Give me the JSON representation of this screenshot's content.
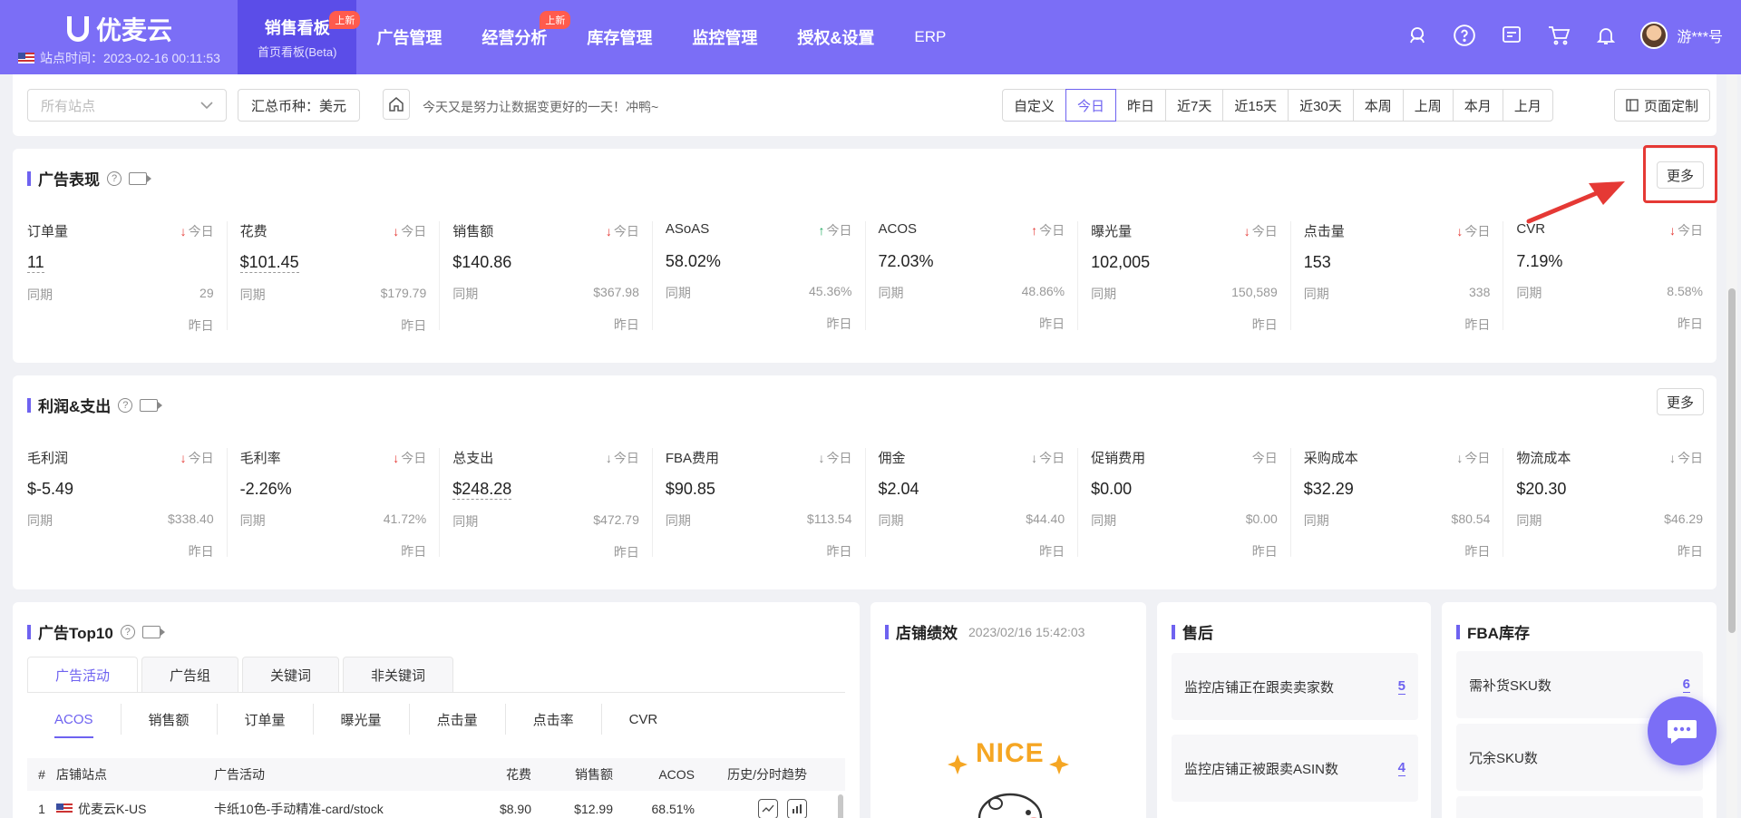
{
  "header": {
    "logo_text": "优麦云",
    "site_time_label": "站点时间：2023-02-16 00:11:53",
    "nav": [
      {
        "label": "销售看板",
        "sub": "首页看板(Beta)",
        "badge": "上新",
        "active": true
      },
      {
        "label": "广告管理",
        "sub": "",
        "badge": "",
        "active": false
      },
      {
        "label": "经营分析",
        "sub": "",
        "badge": "上新",
        "active": false
      },
      {
        "label": "库存管理",
        "sub": "",
        "badge": "",
        "active": false
      },
      {
        "label": "监控管理",
        "sub": "",
        "badge": "",
        "active": false
      },
      {
        "label": "授权&设置",
        "sub": "",
        "badge": "",
        "active": false
      },
      {
        "label": "ERP",
        "sub": "",
        "badge": "",
        "active": false
      }
    ],
    "icons": [
      "headset-icon",
      "help-icon",
      "message-icon",
      "cart-icon",
      "bell-icon"
    ],
    "user_name": "游***号"
  },
  "filters": {
    "site_placeholder": "所有站点",
    "currency_label": "汇总币种：美元",
    "motto": "今天又是努力让数据变更好的一天！冲鸭~",
    "date_ranges": [
      "自定义",
      "今日",
      "昨日",
      "近7天",
      "近15天",
      "近30天",
      "本周",
      "上周",
      "本月",
      "上月"
    ],
    "active_range": "今日",
    "customize_label": "页面定制"
  },
  "ad_performance": {
    "title": "广告表现",
    "more_label": "更多",
    "metrics": [
      {
        "label": "订单量",
        "trend": "down",
        "period": "今日",
        "value": "11",
        "compare_label": "同期",
        "compare_value": "29",
        "sub_label": "昨日",
        "dashed": true
      },
      {
        "label": "花费",
        "trend": "down",
        "period": "今日",
        "value": "$101.45",
        "compare_label": "同期",
        "compare_value": "$179.79",
        "sub_label": "昨日",
        "dashed": true
      },
      {
        "label": "销售额",
        "trend": "down",
        "period": "今日",
        "value": "$140.86",
        "compare_label": "同期",
        "compare_value": "$367.98",
        "sub_label": "昨日",
        "dashed": false
      },
      {
        "label": "ASoAS",
        "trend": "up-green",
        "period": "今日",
        "value": "58.02%",
        "compare_label": "同期",
        "compare_value": "45.36%",
        "sub_label": "昨日",
        "dashed": false
      },
      {
        "label": "ACOS",
        "trend": "up-red",
        "period": "今日",
        "value": "72.03%",
        "compare_label": "同期",
        "compare_value": "48.86%",
        "sub_label": "昨日",
        "dashed": false
      },
      {
        "label": "曝光量",
        "trend": "down",
        "period": "今日",
        "value": "102,005",
        "compare_label": "同期",
        "compare_value": "150,589",
        "sub_label": "昨日",
        "dashed": false
      },
      {
        "label": "点击量",
        "trend": "down",
        "period": "今日",
        "value": "153",
        "compare_label": "同期",
        "compare_value": "338",
        "sub_label": "昨日",
        "dashed": false
      },
      {
        "label": "CVR",
        "trend": "down",
        "period": "今日",
        "value": "7.19%",
        "compare_label": "同期",
        "compare_value": "8.58%",
        "sub_label": "昨日",
        "dashed": false
      }
    ]
  },
  "profit": {
    "title": "利润&支出",
    "more_label": "更多",
    "metrics": [
      {
        "label": "毛利润",
        "trend": "down",
        "period": "今日",
        "value": "$-5.49",
        "compare_label": "同期",
        "compare_value": "$338.40",
        "sub_label": "昨日",
        "dashed": false
      },
      {
        "label": "毛利率",
        "trend": "down",
        "period": "今日",
        "value": "-2.26%",
        "compare_label": "同期",
        "compare_value": "41.72%",
        "sub_label": "昨日",
        "dashed": false
      },
      {
        "label": "总支出",
        "trend": "grey",
        "period": "今日",
        "value": "$248.28",
        "compare_label": "同期",
        "compare_value": "$472.79",
        "sub_label": "昨日",
        "dashed": true
      },
      {
        "label": "FBA费用",
        "trend": "grey",
        "period": "今日",
        "value": "$90.85",
        "compare_label": "同期",
        "compare_value": "$113.54",
        "sub_label": "昨日",
        "dashed": false
      },
      {
        "label": "佣金",
        "trend": "grey",
        "period": "今日",
        "value": "$2.04",
        "compare_label": "同期",
        "compare_value": "$44.40",
        "sub_label": "昨日",
        "dashed": false
      },
      {
        "label": "促销费用",
        "trend": "none",
        "period": "今日",
        "value": "$0.00",
        "compare_label": "同期",
        "compare_value": "$0.00",
        "sub_label": "昨日",
        "dashed": false
      },
      {
        "label": "采购成本",
        "trend": "grey",
        "period": "今日",
        "value": "$32.29",
        "compare_label": "同期",
        "compare_value": "$80.54",
        "sub_label": "昨日",
        "dashed": false
      },
      {
        "label": "物流成本",
        "trend": "grey",
        "period": "今日",
        "value": "$20.30",
        "compare_label": "同期",
        "compare_value": "$46.29",
        "sub_label": "昨日",
        "dashed": false
      }
    ]
  },
  "ad_top10": {
    "title": "广告Top10",
    "tabs": [
      "广告活动",
      "广告组",
      "关键词",
      "非关键词"
    ],
    "active_tab": "广告活动",
    "subtabs": [
      "ACOS",
      "销售额",
      "订单量",
      "曝光量",
      "点击量",
      "点击率",
      "CVR"
    ],
    "active_subtab": "ACOS",
    "columns": {
      "num": "#",
      "store": "店铺站点",
      "campaign": "广告活动",
      "spend": "花费",
      "sales": "销售额",
      "acos": "ACOS",
      "trend": "历史/分时趋势"
    },
    "rows": [
      {
        "num": "1",
        "store": "优麦云K-US",
        "campaign": "卡纸10色-手动精准-card/stock",
        "spend": "$8.90",
        "sales": "$12.99",
        "acos": "68.51%"
      }
    ]
  },
  "store_perf": {
    "title": "店铺绩效",
    "time": "2023/02/16 15:42:03",
    "sticker_text": "NICE"
  },
  "after_sales": {
    "title": "售后",
    "items": [
      {
        "label": "监控店铺正在跟卖卖家数",
        "value": "5"
      },
      {
        "label": "监控店铺正被跟卖ASIN数",
        "value": "4"
      }
    ]
  },
  "fba_inventory": {
    "title": "FBA库存",
    "items": [
      {
        "label": "需补货SKU数",
        "value": "6"
      },
      {
        "label": "冗余SKU数",
        "value": ""
      }
    ]
  },
  "colors": {
    "brand": "#7b6ef6",
    "accent": "#6e62f0",
    "down": "#e53935",
    "up_green": "#19a85b",
    "highlight": "#e53935"
  }
}
